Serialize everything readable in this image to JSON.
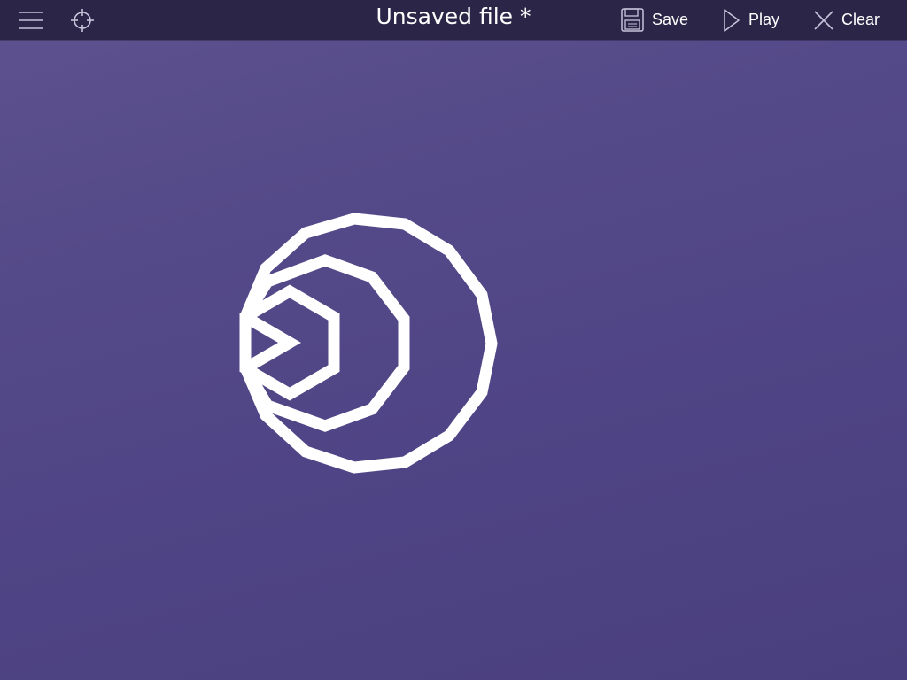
{
  "toolbar": {
    "menu_icon": "hamburger-menu-icon",
    "locate_icon": "crosshair-icon",
    "title": "Unsaved file *",
    "save_label": "Save",
    "save_icon": "floppy-disk-icon",
    "play_label": "Play",
    "play_icon": "play-triangle-icon",
    "clear_label": "Clear",
    "clear_icon": "x-close-icon"
  },
  "colors": {
    "toolbar_bg": "#2b2547",
    "canvas_bg_top": "#5e528f",
    "canvas_bg_bottom": "#4a3f7e",
    "stroke": "#ffffff",
    "icon": "#c8c4dc"
  },
  "drawing": {
    "shapes": [
      "outer-polygon",
      "middle-polygon",
      "inner-hexagon",
      "arrowhead"
    ]
  }
}
